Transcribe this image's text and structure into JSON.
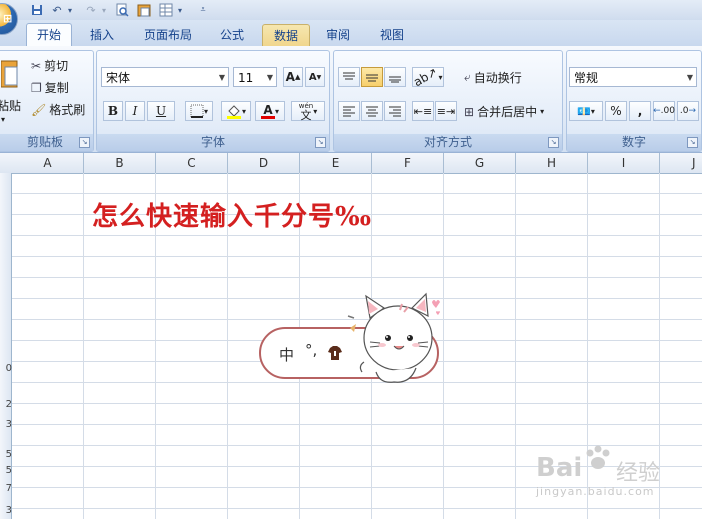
{
  "quick_access": {
    "icons": [
      "save-icon",
      "undo-icon",
      "redo-icon",
      "print-preview-icon",
      "paste-icon",
      "table-icon",
      "customize-icon"
    ]
  },
  "tabs": [
    {
      "label": "开始",
      "state": "active"
    },
    {
      "label": "插入",
      "state": "normal"
    },
    {
      "label": "页面布局",
      "state": "normal"
    },
    {
      "label": "公式",
      "state": "normal"
    },
    {
      "label": "数据",
      "state": "highlighted"
    },
    {
      "label": "审阅",
      "state": "normal"
    },
    {
      "label": "视图",
      "state": "normal"
    }
  ],
  "clipboard": {
    "paste": "粘贴",
    "cut": "剪切",
    "copy": "复制",
    "format_painter": "格式刷",
    "label": "剪贴板"
  },
  "font": {
    "family": "宋体",
    "size": "11",
    "label": "字体",
    "bold": "B",
    "italic": "I",
    "underline": "U",
    "grow": "A",
    "shrink": "A",
    "font_color_letter": "A",
    "phonetic": "文",
    "phonetic_top": "wén"
  },
  "alignment": {
    "wrap": "自动换行",
    "merge": "合并后居中",
    "label": "对齐方式"
  },
  "number": {
    "format": "常规",
    "percent": "%",
    "comma": ",",
    "inc_decimal": ".00",
    "dec_decimal": ".0",
    "label": "数字"
  },
  "columns": [
    "A",
    "B",
    "C",
    "D",
    "E",
    "F",
    "G",
    "H",
    "I",
    "J"
  ],
  "row_numbers": [
    "0",
    "2",
    "3",
    "5",
    "5",
    "7",
    "3"
  ],
  "sheet": {
    "title": "怎么快速输入千分号‰"
  },
  "ime": {
    "mode": "中",
    "punct": "°,"
  },
  "watermark": {
    "brand": "Bai",
    "brand2": "经验",
    "url": "jingyan.baidu.com"
  },
  "colors": {
    "title_red": "#d42020",
    "ribbon_blue": "#15428b"
  }
}
